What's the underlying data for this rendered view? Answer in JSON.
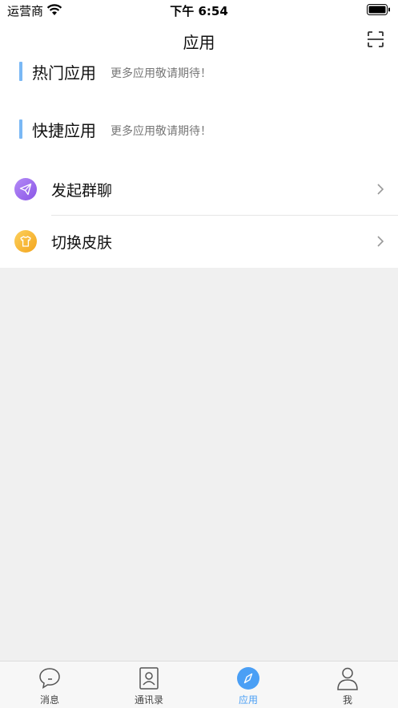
{
  "status_bar": {
    "carrier": "运营商",
    "time": "下午 6:54"
  },
  "nav": {
    "title": "应用",
    "scan_icon": "scan-icon"
  },
  "sections": [
    {
      "title": "热门应用",
      "subtitle": "更多应用敬请期待！"
    },
    {
      "title": "快捷应用",
      "subtitle": "更多应用敬请期待！"
    }
  ],
  "menu": [
    {
      "label": "发起群聊",
      "icon": "paper-plane-icon",
      "color": "#9b6bf0"
    },
    {
      "label": "切换皮肤",
      "icon": "tshirt-icon",
      "color": "#f7b52c"
    }
  ],
  "tabs": [
    {
      "label": "消息",
      "icon": "chat-bubble-icon",
      "active": false
    },
    {
      "label": "通讯录",
      "icon": "contacts-icon",
      "active": false
    },
    {
      "label": "应用",
      "icon": "compass-icon",
      "active": true
    },
    {
      "label": "我",
      "icon": "person-icon",
      "active": false
    }
  ],
  "colors": {
    "accent": "#4a9ff5",
    "section_bar": "#7ab8f5",
    "background": "#f0f0f0"
  }
}
